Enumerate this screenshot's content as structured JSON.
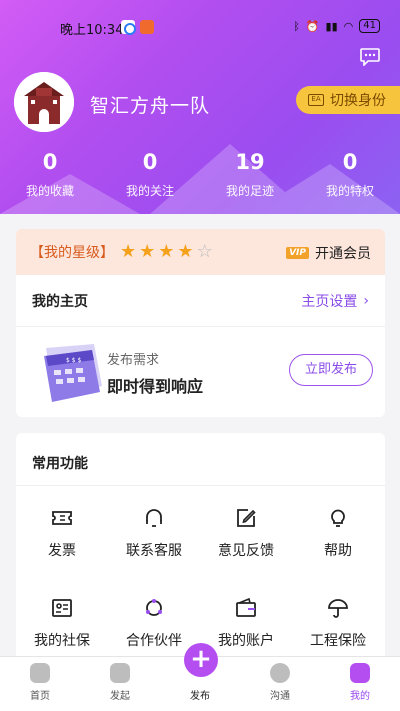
{
  "status_bar": {
    "time": "晚上10:34",
    "right_text": "",
    "battery": "41"
  },
  "profile": {
    "team_name": "智汇方舟一队",
    "switch_label": "切换身份",
    "switch_icon_text": "EA"
  },
  "stats": [
    {
      "value": "0",
      "label": "我的收藏"
    },
    {
      "value": "0",
      "label": "我的关注"
    },
    {
      "value": "19",
      "label": "我的足迹"
    },
    {
      "value": "0",
      "label": "我的特权"
    }
  ],
  "star_level": {
    "label": "【我的星级】",
    "stars_filled": 4,
    "stars_total": 5,
    "vip_badge": "VIP",
    "vip_label": "开通会员"
  },
  "homepage": {
    "title": "我的主页",
    "settings_link": "主页设置",
    "publish_sub": "发布需求",
    "publish_main": "即时得到响应",
    "publish_button": "立即发布",
    "illustration_text": "$ $ $"
  },
  "functions": {
    "title": "常用功能",
    "items": [
      {
        "label": "发票",
        "icon": "ticket-icon"
      },
      {
        "label": "联系客服",
        "icon": "headset-icon"
      },
      {
        "label": "意见反馈",
        "icon": "edit-icon"
      },
      {
        "label": "帮助",
        "icon": "lightbulb-icon"
      },
      {
        "label": "我的社保",
        "icon": "id-card-icon"
      },
      {
        "label": "合作伙伴",
        "icon": "partners-icon"
      },
      {
        "label": "我的账户",
        "icon": "wallet-icon"
      },
      {
        "label": "工程保险",
        "icon": "umbrella-icon"
      }
    ]
  },
  "tabbar": [
    {
      "label": "首页",
      "icon": "home-icon"
    },
    {
      "label": "发起",
      "icon": "cube-icon"
    },
    {
      "label": "发布",
      "icon": "plus-icon"
    },
    {
      "label": "沟通",
      "icon": "chat-icon"
    },
    {
      "label": "我的",
      "icon": "user-icon"
    }
  ],
  "colors": {
    "accent": "#9a4df0",
    "gold": "#f7c43d",
    "star": "#f5a11c"
  }
}
